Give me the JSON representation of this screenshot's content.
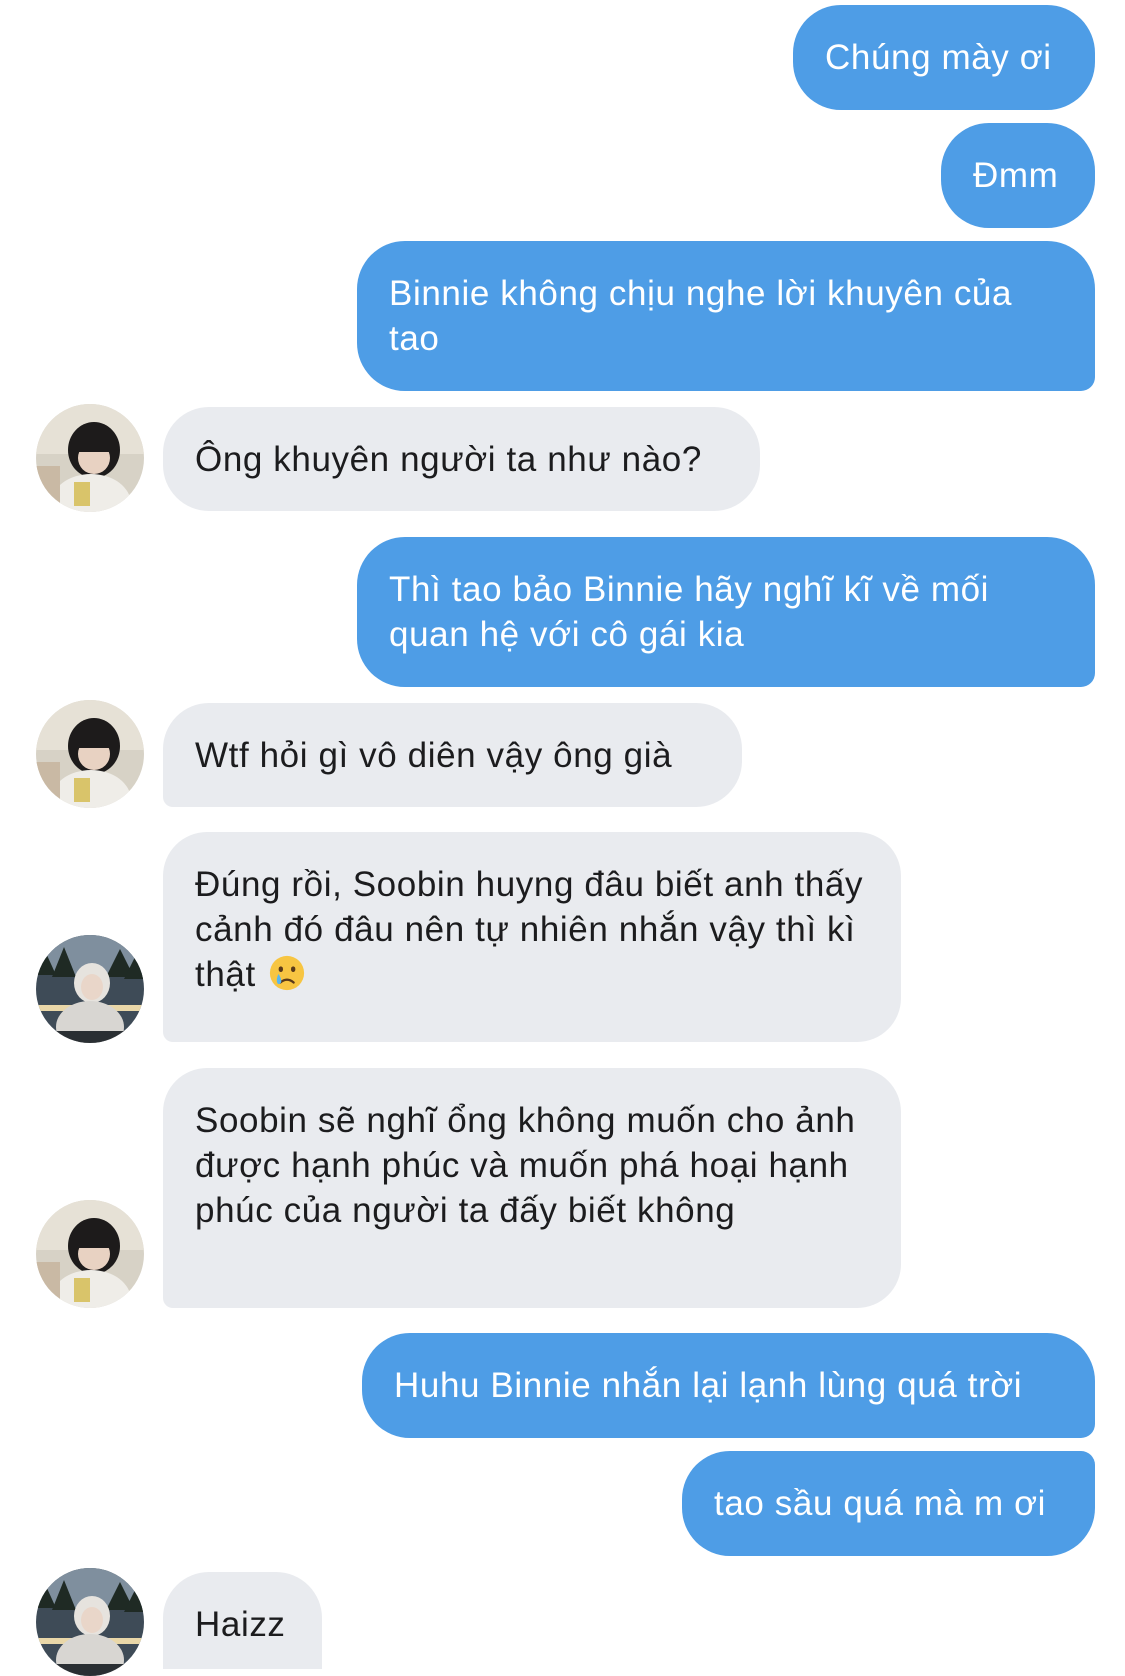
{
  "messages": [
    {
      "sender": "me",
      "text": "Chúng mày ơi"
    },
    {
      "sender": "me",
      "text": "Đmm"
    },
    {
      "sender": "me",
      "text": "Binnie không chịu nghe lời khuyên của tao"
    },
    {
      "sender": "friend_a",
      "text": "Ông khuyên người ta như nào?"
    },
    {
      "sender": "me",
      "text": "Thì tao bảo Binnie hãy nghĩ kĩ về mối quan hệ với cô gái kia"
    },
    {
      "sender": "friend_a",
      "text": "Wtf hỏi gì vô diên vậy ông già"
    },
    {
      "sender": "friend_b",
      "text": "Đúng rồi, Soobin huyng đâu biết anh thấy cảnh đó đâu nên tự nhiên nhắn vậy thì kì thật",
      "emoji": "crying-face-icon"
    },
    {
      "sender": "friend_a",
      "text": "Soobin sẽ nghĩ ổng không muốn cho ảnh được hạnh phúc và muốn phá hoại hạnh phúc của người ta đấy biết không"
    },
    {
      "sender": "me",
      "text": "Huhu Binnie nhắn lại lạnh lùng quá trời"
    },
    {
      "sender": "me",
      "text": "tao sầu quá mà m ơi"
    },
    {
      "sender": "friend_b",
      "text": "Haizz"
    }
  ],
  "colors": {
    "outgoing_bubble": "#4e9de6",
    "incoming_bubble": "#e9ebef",
    "outgoing_text": "#ffffff",
    "incoming_text": "#1c1c1e",
    "background": "#ffffff"
  }
}
